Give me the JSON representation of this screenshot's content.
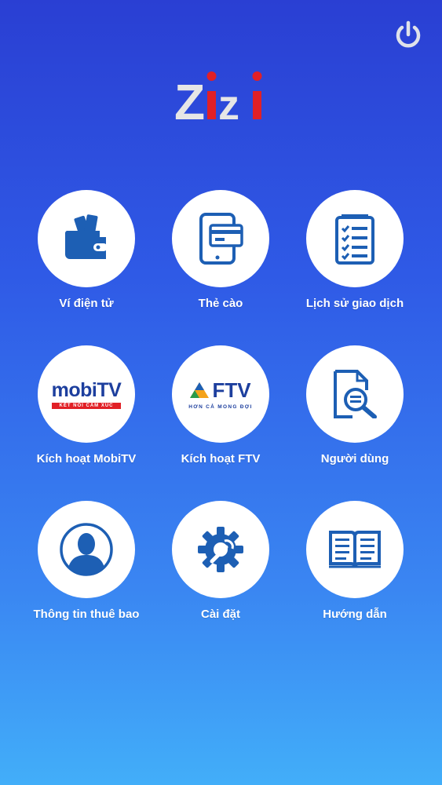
{
  "header": {
    "logo_text": "Zizi",
    "power_icon": "power-icon"
  },
  "colors": {
    "background_top": "#2a3fd3",
    "background_bottom": "#42aef9",
    "icon_blue": "#1d5fb4",
    "logo_red": "#e12026",
    "logo_gray": "#e6e6e6"
  },
  "menu": [
    {
      "label": "Ví điện tử",
      "icon": "wallet-icon"
    },
    {
      "label": "Thẻ cào",
      "icon": "card-tablet-icon"
    },
    {
      "label": "Lịch sử giao dịch",
      "icon": "checklist-icon"
    },
    {
      "label": "Kích hoạt MobiTV",
      "icon": "mobitv-logo",
      "logo_text": "mobiTV",
      "logo_tagline": "KẾT NỐI CẢM XÚC"
    },
    {
      "label": "Kích hoạt FTV",
      "icon": "ftv-logo",
      "logo_text": "FTV",
      "logo_tagline": "HƠN CẢ MONG ĐỢI"
    },
    {
      "label": "Người dùng",
      "icon": "document-search-icon"
    },
    {
      "label": "Thông tin thuê bao",
      "icon": "user-profile-icon"
    },
    {
      "label": "Cài đặt",
      "icon": "settings-gear-icon"
    },
    {
      "label": "Hướng dẫn",
      "icon": "open-book-icon"
    }
  ]
}
